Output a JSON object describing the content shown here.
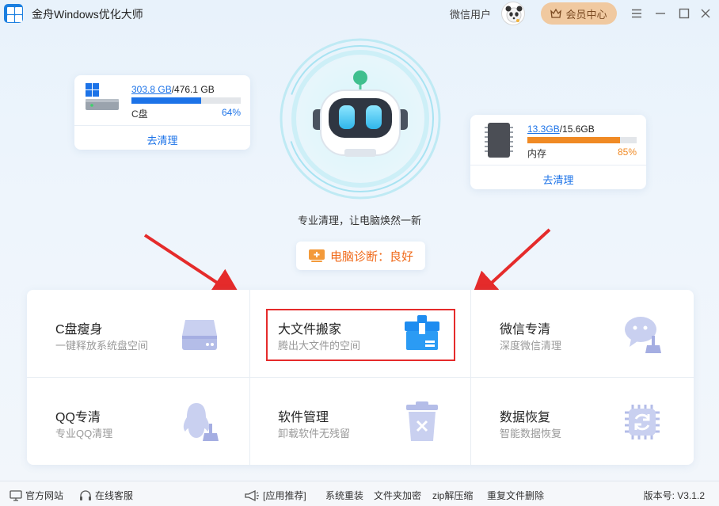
{
  "titlebar": {
    "app_title": "金舟Windows优化大师",
    "user_name": "微信用户",
    "vip_label": "会员中心"
  },
  "disk_card": {
    "used": "303.8 GB",
    "total": "/476.1 GB",
    "label": "C盘",
    "percent_text": "64%",
    "percent": 64,
    "action": "去清理",
    "bar_color": "#1c73e8"
  },
  "memory_card": {
    "used": "13.3GB",
    "total": "/15.6GB",
    "label": "内存",
    "percent_text": "85%",
    "percent": 85,
    "action": "去清理",
    "bar_color": "#f08a24"
  },
  "center": {
    "slogan": "专业清理，让电脑焕然一新",
    "diagnosis": "电脑诊断：良好"
  },
  "tools": [
    {
      "title": "C盘瘦身",
      "sub": "一键释放系统盘空间",
      "icon": "disk-icon"
    },
    {
      "title": "大文件搬家",
      "sub": "腾出大文件的空间",
      "icon": "moving-box-icon"
    },
    {
      "title": "微信专清",
      "sub": "深度微信清理",
      "icon": "wechat-clean-icon"
    },
    {
      "title": "QQ专清",
      "sub": "专业QQ清理",
      "icon": "qq-clean-icon"
    },
    {
      "title": "软件管理",
      "sub": "卸载软件无残留",
      "icon": "trash-icon"
    },
    {
      "title": "数据恢复",
      "sub": "智能数据恢复",
      "icon": "data-recovery-icon"
    }
  ],
  "footer": {
    "official_site": "官方网站",
    "online_service": "在线客服",
    "recommend": "[应用推荐]",
    "links": [
      "系统重装",
      "文件夹加密",
      "zip解压缩",
      "重复文件删除"
    ],
    "version": "版本号: V3.1.2"
  },
  "colors": {
    "accent": "#1c73e8",
    "warning": "#f08a24",
    "diagnosis": "#f06a1a",
    "vip_bg": "#f0c9a0",
    "highlight_border": "#e52b2b"
  }
}
